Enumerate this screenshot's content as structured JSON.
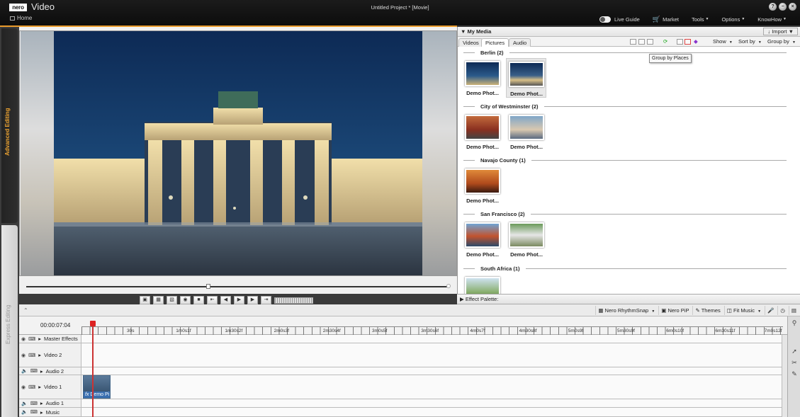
{
  "app": {
    "logo": "nero",
    "name": "Video",
    "home": "Home",
    "project_title": "Untitled Project * [Movie]"
  },
  "window_controls": [
    "?",
    "−",
    "×"
  ],
  "menu": {
    "live_guide": "Live Guide",
    "market": "Market",
    "tools": "Tools",
    "options": "Options",
    "knowhow": "KnowHow"
  },
  "side_tabs": {
    "advanced": "Advanced Editing",
    "express": "Express Editing"
  },
  "preview": {
    "progress_fraction": 0.43
  },
  "media": {
    "title": "My Media",
    "import": "Import",
    "tabs": [
      "Videos",
      "Pictures",
      "Audio"
    ],
    "active_tab": "Pictures",
    "show": "Show",
    "sort_by": "Sort by",
    "group_by": "Group by",
    "tooltip": "Group by Places",
    "groups": [
      {
        "name": "Berlin (2)",
        "items": [
          "Demo Phot...",
          "Demo Phot..."
        ]
      },
      {
        "name": "City of Westminster (2)",
        "items": [
          "Demo Phot...",
          "Demo Phot..."
        ]
      },
      {
        "name": "Navajo County (1)",
        "items": [
          "Demo Phot..."
        ]
      },
      {
        "name": "San Francisco (2)",
        "items": [
          "Demo Phot...",
          "Demo Phot..."
        ]
      },
      {
        "name": "South Africa (1)",
        "items": []
      }
    ]
  },
  "effect_palette": "Effect Palette:",
  "timeline_tools": {
    "rhythm": "Nero RhythmSnap",
    "pip": "Nero PiP",
    "themes": "Themes",
    "fit": "Fit Music"
  },
  "timeline": {
    "timecode": "00:00:07:04",
    "ticks": [
      "30s",
      "1m0s1f",
      "1m30s2f",
      "2m0s3f",
      "2m30s4f",
      "3m0s5f",
      "3m30s6f",
      "4m0s7f",
      "4m30s8f",
      "5m0s9f",
      "5m30s9f",
      "6m0s10f",
      "6m30s11f",
      "7m0s12f"
    ],
    "tracks": [
      "Master Effects",
      "Video 2",
      "Audio 2",
      "Video 1",
      "Audio 1",
      "Music"
    ],
    "clip_label": "Demo Pi"
  },
  "colors": {
    "accent": "#e8a030",
    "playhead": "#cc3333"
  }
}
